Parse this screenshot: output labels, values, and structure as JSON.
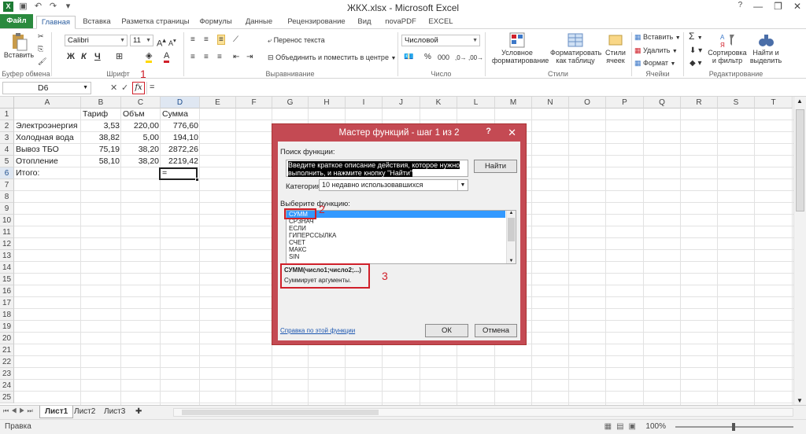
{
  "app": {
    "title": "ЖКХ.xlsx - Microsoft Excel"
  },
  "qat": {
    "save_icon": "save-icon",
    "undo_icon": "undo-icon",
    "redo_icon": "redo-icon"
  },
  "window": {
    "min": "—",
    "max": "❐",
    "close": "✕"
  },
  "tabs": [
    "Файл",
    "Главная",
    "Вставка",
    "Разметка страницы",
    "Формулы",
    "Данные",
    "Рецензирование",
    "Вид",
    "novaPDF",
    "EXCEL"
  ],
  "ribbon": {
    "clipboard": {
      "paste": "Вставить",
      "label": "Буфер обмена"
    },
    "font": {
      "name": "Calibri",
      "size": "11",
      "bold": "Ж",
      "italic": "К",
      "underline": "Ч",
      "label": "Шрифт"
    },
    "alignment": {
      "wrap": "Перенос текста",
      "merge": "Объединить и поместить в центре",
      "label": "Выравнивание"
    },
    "number": {
      "format": "Числовой",
      "percent": "%",
      "thousands": "000",
      "label": "Число"
    },
    "styles": {
      "cond": "Условное форматирование",
      "table": "Форматировать как таблицу",
      "cell": "Стили ячеек",
      "label": "Стили"
    },
    "cells": {
      "insert": "Вставить",
      "delete": "Удалить",
      "format": "Формат",
      "label": "Ячейки"
    },
    "editing": {
      "sum": "Σ",
      "sort": "Сортировка и фильтр",
      "find": "Найти и выделить",
      "label": "Редактирование"
    }
  },
  "formula_bar": {
    "name_box": "D6",
    "cancel": "✕",
    "enter": "✓",
    "fx": "fx",
    "value": "="
  },
  "annotations": {
    "one": "1",
    "two": "2",
    "three": "3"
  },
  "columns": [
    "A",
    "B",
    "C",
    "D",
    "E",
    "F",
    "G",
    "H",
    "I",
    "J",
    "K",
    "L",
    "M",
    "N",
    "O",
    "P",
    "Q",
    "R",
    "S",
    "T"
  ],
  "rows": [
    "1",
    "2",
    "3",
    "4",
    "5",
    "6",
    "7",
    "8",
    "9",
    "10",
    "11",
    "12",
    "13",
    "14",
    "15",
    "16",
    "17",
    "18",
    "19",
    "20",
    "21",
    "22",
    "23",
    "24",
    "25"
  ],
  "cells": {
    "B1": "Тариф",
    "C1": "Объм",
    "D1": "Сумма",
    "A2": "Электроэнергия",
    "B2": "3,53",
    "C2": "220,00",
    "D2": "776,60",
    "A3": "Холодная вода",
    "B3": "38,82",
    "C3": "5,00",
    "D3": "194,10",
    "A4": "Вывоз ТБО",
    "B4": "75,19",
    "C4": "38,20",
    "D4": "2872,26",
    "A5": "Отопление",
    "B5": "58,10",
    "C5": "38,20",
    "D5": "2219,42",
    "A6": "Итого:",
    "D6": "="
  },
  "sheets": [
    "Лист1",
    "Лист2",
    "Лист3"
  ],
  "status": {
    "ready": "Правка",
    "zoom": "100%"
  },
  "dialog": {
    "title": "Мастер функций - шаг 1 из 2",
    "help": "?",
    "close": "✕",
    "search_label": "Поиск функции:",
    "search_value": "Введите краткое описание действия, которое нужно выполнить, и нажмите кнопку \"Найти\"",
    "find_button": "Найти",
    "category_label": "Категория:",
    "category_value": "10 недавно использовавшихся",
    "select_label": "Выберите функцию:",
    "functions": [
      "СУММ",
      "СРЗНАЧ",
      "ЕСЛИ",
      "ГИПЕРССЫЛКА",
      "СЧЕТ",
      "МАКС",
      "SIN"
    ],
    "signature": "СУММ(число1;число2;...)",
    "description": "Суммирует аргументы.",
    "help_link": "Справка по этой функции",
    "ok": "ОК",
    "cancel": "Отмена"
  }
}
